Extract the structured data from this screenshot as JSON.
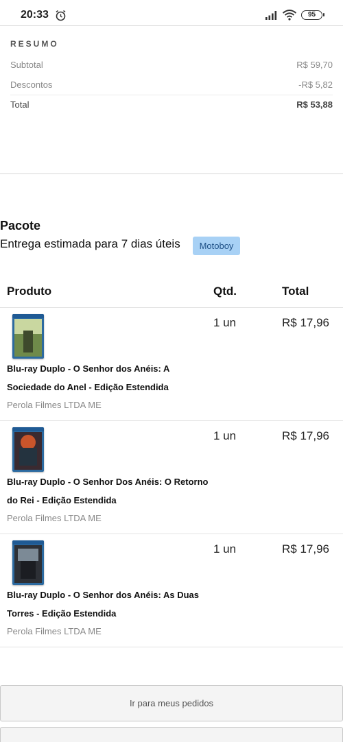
{
  "status_bar": {
    "time": "20:33",
    "battery": "95",
    "icons": [
      "alarm-icon",
      "signal-icon",
      "wifi-icon",
      "battery-icon"
    ]
  },
  "summary": {
    "title": "RESUMO",
    "subtotal_label": "Subtotal",
    "subtotal_value": "R$ 59,70",
    "discount_label": "Descontos",
    "discount_value": "-R$ 5,82",
    "total_label": "Total",
    "total_value": "R$ 53,88"
  },
  "package": {
    "title": "Pacote",
    "delivery": "Entrega estimada para 7 dias úteis",
    "shipping_badge": "Motoboy",
    "badge_color": "#a8d1f5"
  },
  "table": {
    "headers": {
      "product": "Produto",
      "qty": "Qtd.",
      "total": "Total"
    },
    "items": [
      {
        "name": "Blu-ray Duplo - O Senhor dos Anéis: A Sociedade do Anel - Edição Estendida",
        "seller": "Perola Filmes LTDA ME",
        "qty": "1 un",
        "price": "R$ 17,96"
      },
      {
        "name": "Blu-ray Duplo - O Senhor Dos Anéis: O Retorno do Rei - Edição Estendida",
        "seller": "Perola Filmes LTDA ME",
        "qty": "1 un",
        "price": "R$ 17,96"
      },
      {
        "name": "Blu-ray Duplo - O Senhor dos Anéis: As Duas Torres - Edição Estendida",
        "seller": "Perola Filmes LTDA ME",
        "qty": "1 un",
        "price": "R$ 17,96"
      }
    ]
  },
  "actions": {
    "primary": "Ir para meus pedidos"
  }
}
